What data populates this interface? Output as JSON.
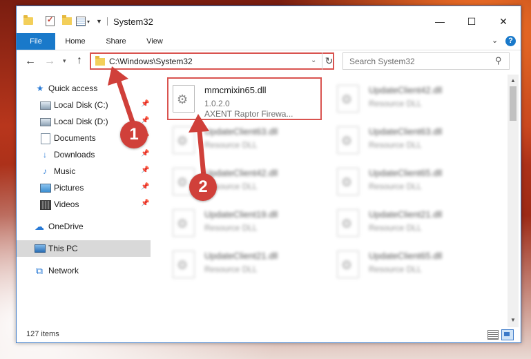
{
  "window": {
    "title": "System32",
    "controls": {
      "minimize": "—",
      "maximize": "☐",
      "close": "✕"
    }
  },
  "ribbon": {
    "tabs": [
      "File",
      "Home",
      "Share",
      "View"
    ],
    "help": "?"
  },
  "address": {
    "path": "C:\\Windows\\System32",
    "search_placeholder": "Search System32"
  },
  "sidebar": {
    "items": [
      {
        "label": "Quick access",
        "icon": "star-icon",
        "pinned": false
      },
      {
        "label": "Local Disk (C:)",
        "icon": "disk-icon",
        "pinned": true
      },
      {
        "label": "Local Disk (D:)",
        "icon": "disk-icon",
        "pinned": true
      },
      {
        "label": "Documents",
        "icon": "document-icon",
        "pinned": true
      },
      {
        "label": "Downloads",
        "icon": "download-icon",
        "pinned": true
      },
      {
        "label": "Music",
        "icon": "music-icon",
        "pinned": true
      },
      {
        "label": "Pictures",
        "icon": "pictures-icon",
        "pinned": true
      },
      {
        "label": "Videos",
        "icon": "videos-icon",
        "pinned": true
      },
      {
        "label": "OneDrive",
        "icon": "cloud-icon",
        "pinned": false
      },
      {
        "label": "This PC",
        "icon": "computer-icon",
        "pinned": false,
        "selected": true
      },
      {
        "label": "Network",
        "icon": "network-icon",
        "pinned": false
      }
    ]
  },
  "files": [
    {
      "name": "mmcmixin65.dll",
      "line1": "1.0.2.0",
      "line2": "AXENT Raptor Firewa...",
      "highlighted": true
    },
    {
      "name": "UpdateClient42.dll",
      "line1": "Resource DLL"
    },
    {
      "name": "UpdateClient63.dll",
      "line1": "Resource DLL"
    },
    {
      "name": "UpdateClient63.dll",
      "line1": "Resource DLL"
    },
    {
      "name": "UpdateClient42.dll",
      "line1": "Resource DLL"
    },
    {
      "name": "UpdateClient65.dll",
      "line1": "Resource DLL"
    },
    {
      "name": "UpdateClient19.dll",
      "line1": "Resource DLL"
    },
    {
      "name": "UpdateClient21.dll",
      "line1": "Resource DLL"
    },
    {
      "name": "UpdateClient21.dll",
      "line1": "Resource DLL"
    },
    {
      "name": "UpdateClient65.dll",
      "line1": "Resource DLL"
    }
  ],
  "status": {
    "item_count": "127 items"
  },
  "callouts": {
    "first": "1",
    "second": "2"
  },
  "colors": {
    "accent": "#1979ca",
    "highlight": "#d9534f",
    "callout": "#d0403a"
  }
}
